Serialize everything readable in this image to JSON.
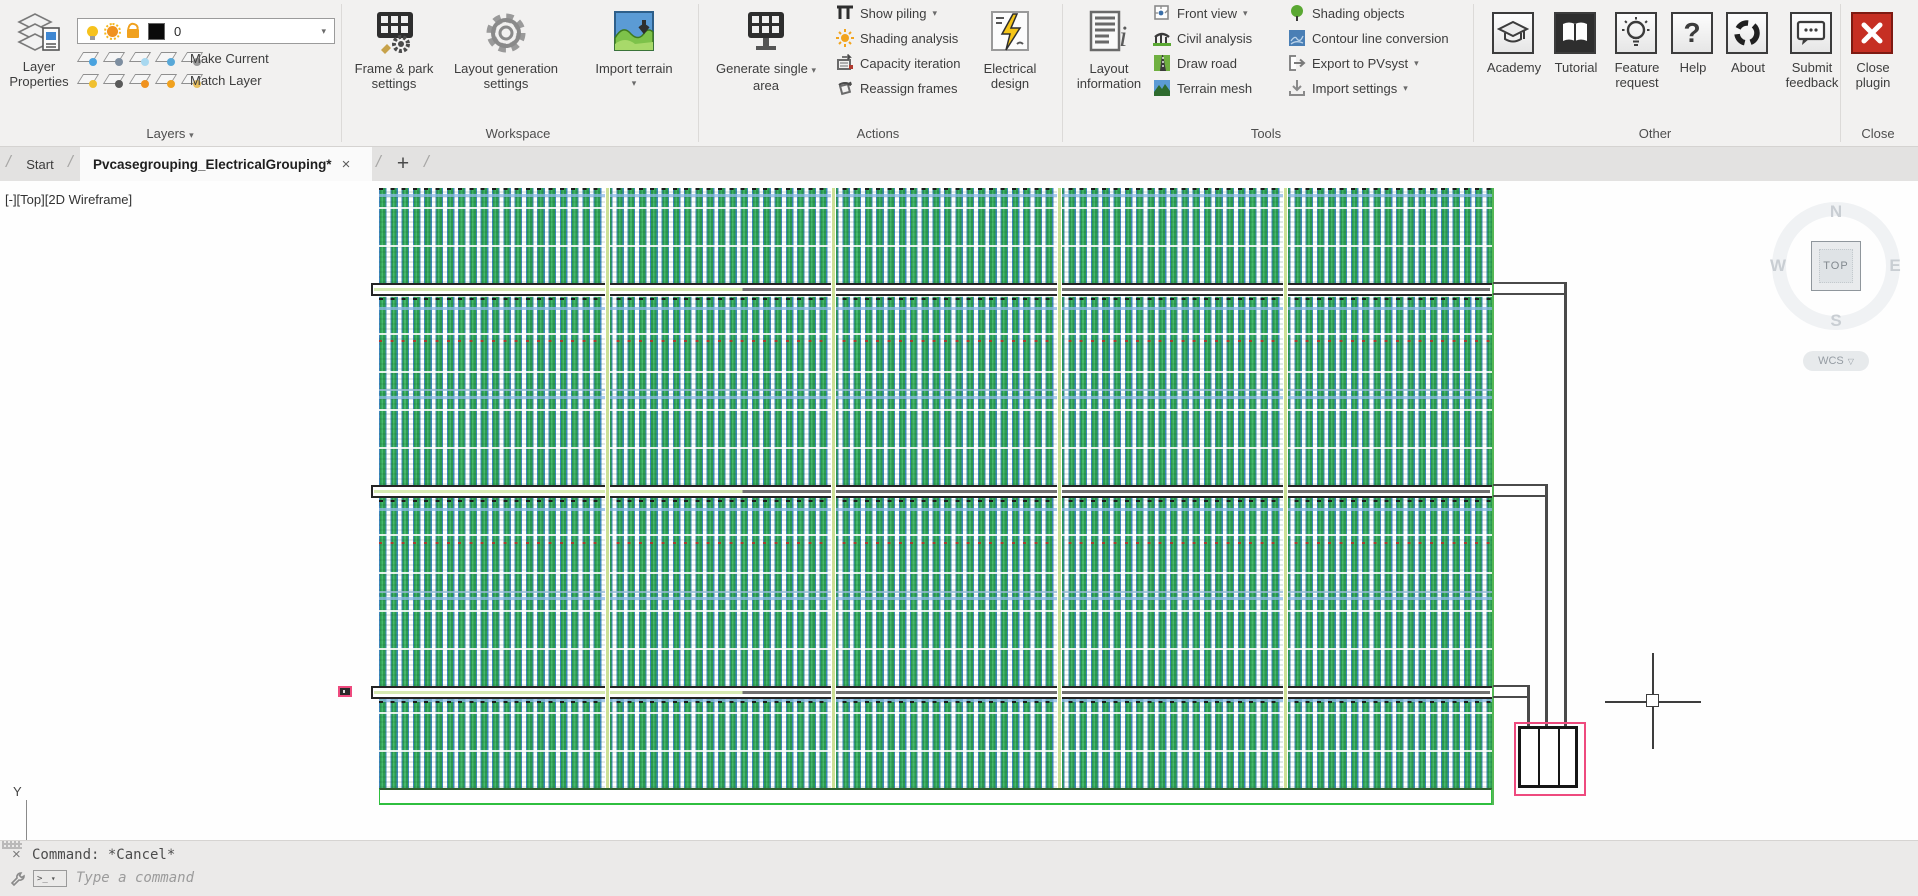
{
  "glyphs": {
    "caret": "▾",
    "caret_outline": "▽",
    "slash": "/",
    "close": "×",
    "plus": "+",
    "prompt": ">_",
    "help": "?",
    "ellipsis": "..."
  },
  "ribbon": {
    "layers": {
      "group_label": "Layers",
      "properties_line1": "Layer",
      "properties_line2": "Properties",
      "combo_value": "0",
      "make_current": "Make Current",
      "match_layer": "Match Layer"
    },
    "workspace": {
      "group_label": "Workspace",
      "frame_park_line1": "Frame & park",
      "frame_park_line2": "settings",
      "layout_gen_line1": "Layout generation",
      "layout_gen_line2": "settings",
      "import_terrain": "Import terrain"
    },
    "actions": {
      "group_label": "Actions",
      "generate_line1": "Generate single",
      "generate_line2": "area",
      "show_piling": "Show piling",
      "shading_analysis": "Shading analysis",
      "capacity_iteration": "Capacity iteration",
      "reassign_frames": "Reassign frames",
      "electrical_line1": "Electrical",
      "electrical_line2": "design"
    },
    "tools": {
      "group_label": "Tools",
      "layout_info_line1": "Layout",
      "layout_info_line2": "information",
      "front_view": "Front view",
      "civil_analysis": "Civil analysis",
      "draw_road": "Draw road",
      "terrain_mesh": "Terrain mesh",
      "shading_objects": "Shading objects",
      "contour_line": "Contour line conversion",
      "export_pvsyst": "Export to PVsyst",
      "import_settings": "Import settings"
    },
    "other": {
      "group_label": "Other",
      "academy": "Academy",
      "tutorial": "Tutorial",
      "feature_line1": "Feature",
      "feature_line2": "request",
      "help": "Help",
      "about": "About",
      "submit_line1": "Submit",
      "submit_line2": "feedback"
    },
    "close": {
      "group_label": "Close",
      "close_line1": "Close",
      "close_line2": "plugin"
    }
  },
  "tabs": {
    "start": "Start",
    "active": "Pvcasegrouping_ElectricalGrouping*"
  },
  "canvas": {
    "viewport_label": "[-][Top][2D Wireframe]",
    "axis_label": "Y"
  },
  "viewcube": {
    "north": "N",
    "west": "W",
    "east": "E",
    "south": "S",
    "top": "TOP",
    "wcs": "WCS"
  },
  "command_line": {
    "history": "Command: *Cancel*",
    "placeholder": "Type a command"
  },
  "colors": {
    "panel_green": "#2c9b51",
    "panel_blue": "#3f87bd",
    "section_divider": "#cde096",
    "selection_pink": "#ee4a7e",
    "wire": "#4a4a4a",
    "array_boundary_green": "#2fbf3f",
    "close_button_red": "#c62f23",
    "ribbon_bg": "#f2f1f0"
  }
}
